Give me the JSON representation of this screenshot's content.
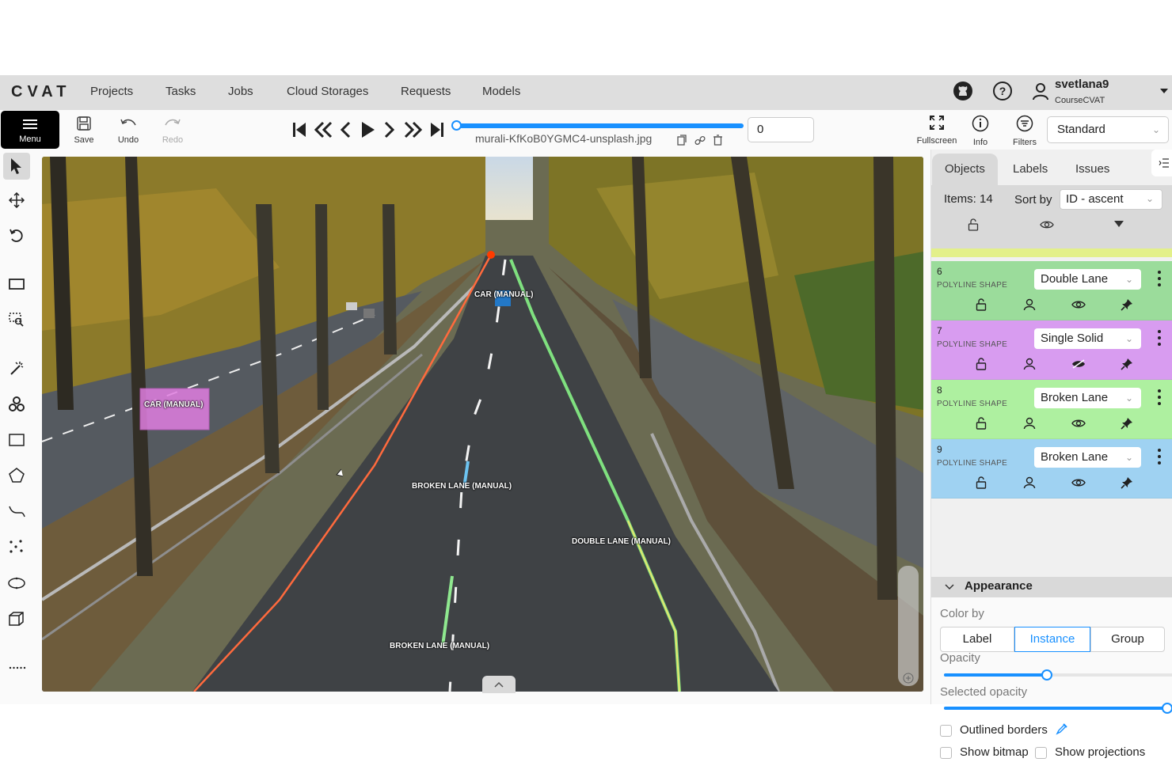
{
  "app": {
    "logo": "CVAT"
  },
  "nav": {
    "items": [
      "Projects",
      "Tasks",
      "Jobs",
      "Cloud Storages",
      "Requests",
      "Models"
    ]
  },
  "user": {
    "name": "svetlana9",
    "org": "CourseCVAT"
  },
  "toolbar": {
    "menu_label": "Menu",
    "save_label": "Save",
    "undo_label": "Undo",
    "redo_label": "Redo",
    "filename": "murali-KfKoB0YGMC4-unsplash.jpg",
    "frame_value": "0",
    "frame_progress": 0,
    "fullscreen_label": "Fullscreen",
    "info_label": "Info",
    "filters_label": "Filters",
    "workspace": "Standard"
  },
  "canvas_labels": {
    "car1": "CAR (MANUAL)",
    "car2": "CAR (MANUAL)",
    "broken1": "BROKEN LANE (MANUAL)",
    "double": "DOUBLE LANE (MANUAL)",
    "broken2": "BROKEN LANE (MANUAL)"
  },
  "sidebar": {
    "tabs": [
      "Objects",
      "Labels",
      "Issues"
    ],
    "items_count": "Items: 14",
    "sort_by_label": "Sort by",
    "sort_value": "ID - ascent",
    "objects": [
      {
        "id": "6",
        "type": "POLYLINE SHAPE",
        "label": "Double Lane",
        "color": "#9bdc9b",
        "hidden": false
      },
      {
        "id": "7",
        "type": "POLYLINE SHAPE",
        "label": "Single Solid",
        "color": "#d89cf0",
        "hidden": true
      },
      {
        "id": "8",
        "type": "POLYLINE SHAPE",
        "label": "Broken Lane",
        "color": "#aef0a0",
        "hidden": false
      },
      {
        "id": "9",
        "type": "POLYLINE SHAPE",
        "label": "Broken Lane",
        "color": "#9fd2f2",
        "hidden": false
      }
    ]
  },
  "appearance": {
    "title": "Appearance",
    "color_by_label": "Color by",
    "color_by_options": [
      "Label",
      "Instance",
      "Group"
    ],
    "color_by_selected": "Instance",
    "opacity_label": "Opacity",
    "opacity_value": 0.45,
    "selected_opacity_label": "Selected opacity",
    "selected_opacity_value": 1.0,
    "outlined_borders_label": "Outlined borders",
    "show_bitmap_label": "Show bitmap",
    "show_projections_label": "Show projections"
  }
}
